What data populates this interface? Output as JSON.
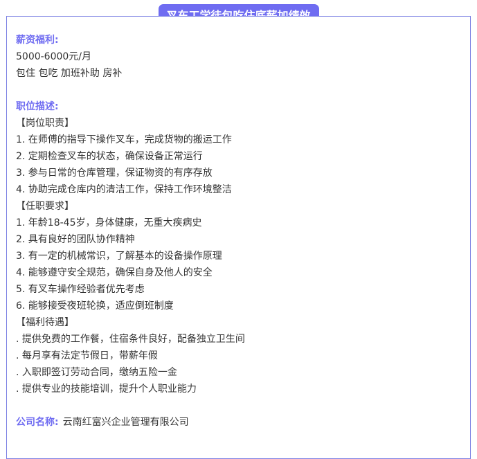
{
  "title": "叉车工学徒包吃住底薪加绩效",
  "salary": {
    "label": "薪资福利:",
    "range": "5000-6000元/月",
    "perks": "包住 包吃 加班补助 房补"
  },
  "description": {
    "label": "职位描述:",
    "sections": [
      {
        "heading": "【岗位职责】",
        "items": [
          "1. 在师傅的指导下操作叉车，完成货物的搬运工作",
          "2. 定期检查叉车的状态，确保设备正常运行",
          "3. 参与日常的仓库管理，保证物资的有序存放",
          "4. 协助完成仓库内的清洁工作，保持工作环境整洁"
        ]
      },
      {
        "heading": "【任职要求】",
        "items": [
          "1. 年龄18-45岁，身体健康，无重大疾病史",
          "2. 具有良好的团队协作精神",
          "3. 有一定的机械常识，了解基本的设备操作原理",
          "4. 能够遵守安全规范，确保自身及他人的安全",
          "5. 有叉车操作经验者优先考虑",
          "6. 能够接受夜班轮换，适应倒班制度"
        ]
      },
      {
        "heading": "【福利待遇】",
        "items": [
          ". 提供免费的工作餐，住宿条件良好，配备独立卫生间",
          ". 每月享有法定节假日，带薪年假",
          ". 入职即签订劳动合同，缴纳五险一金",
          ". 提供专业的技能培训，提升个人职业能力"
        ]
      }
    ]
  },
  "company": {
    "label": "公司名称:",
    "name": "云南红富兴企业管理有限公司"
  },
  "colors": {
    "accent": "#6f6cf1",
    "border": "#7a7fe3",
    "text": "#333333"
  }
}
